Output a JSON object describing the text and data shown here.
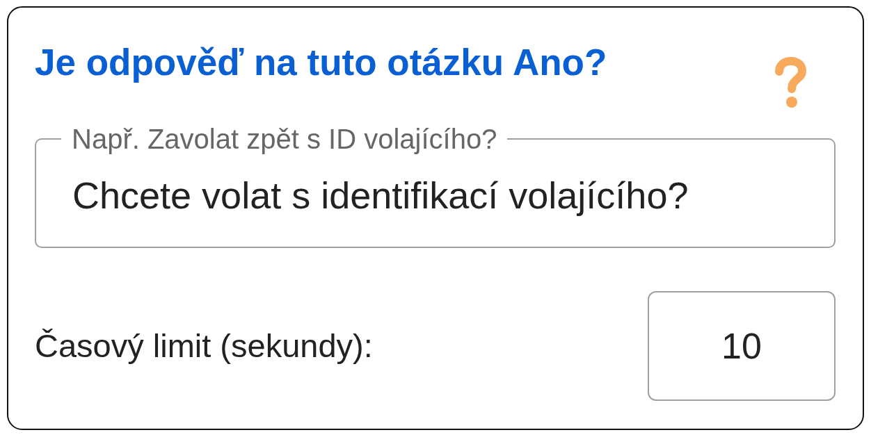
{
  "title": "Je odpověď na tuto otázku Ano?",
  "question_field": {
    "label": "Např. Zavolat zpět s ID volajícího?",
    "value": "Chcete volat s identifikací volajícího?"
  },
  "timeout": {
    "label": "Časový limit (sekundy):",
    "value": "10"
  }
}
